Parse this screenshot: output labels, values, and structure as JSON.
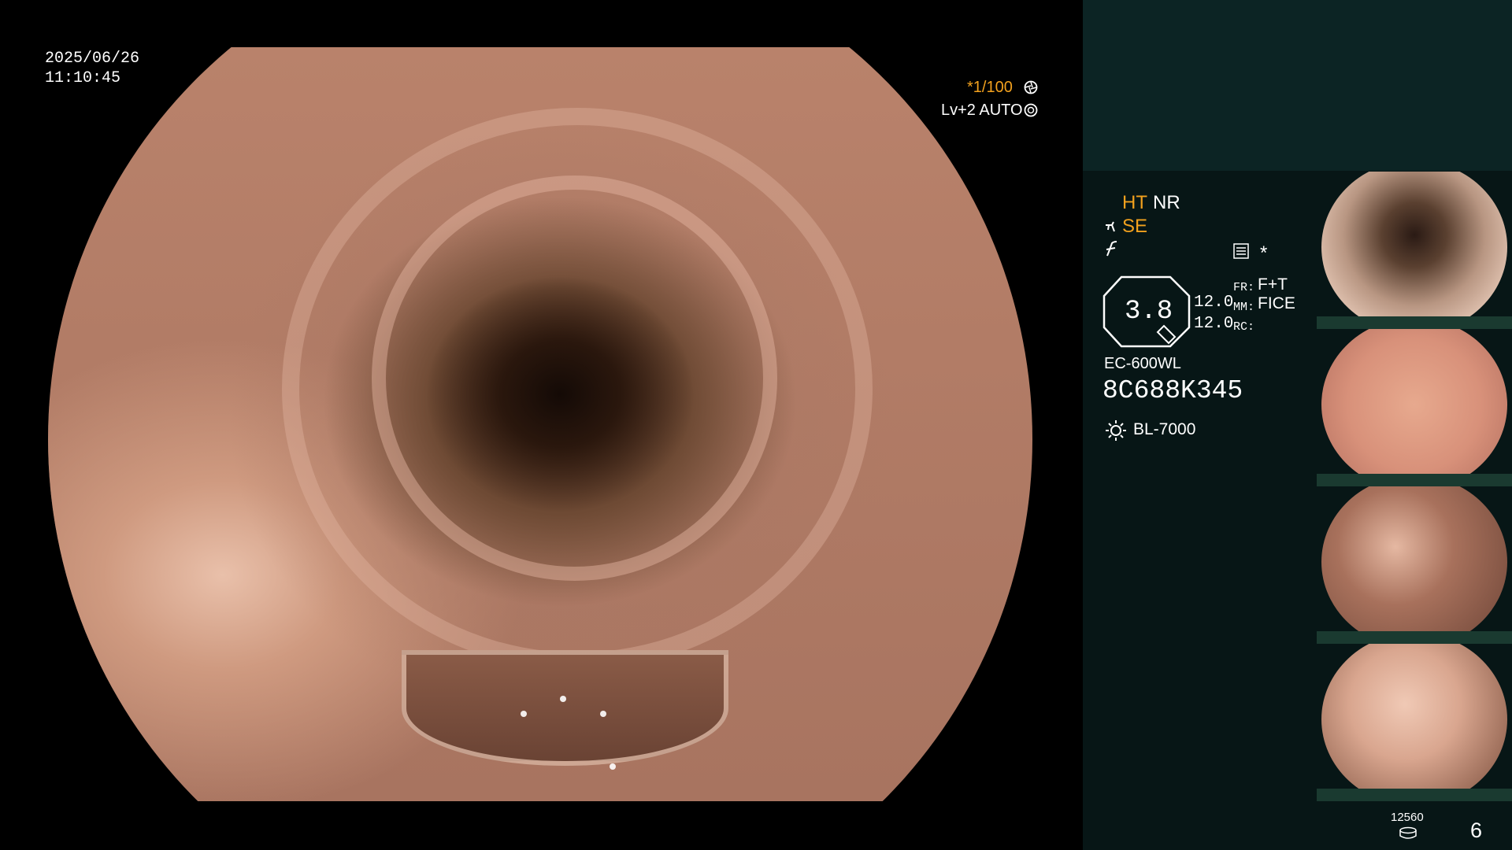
{
  "overlay": {
    "date": "2025/06/26",
    "time": "11:10:45",
    "shutter": "*1/100",
    "level": "Lv+2 AUTO"
  },
  "panel": {
    "ht": "HT",
    "nr": "NR",
    "se": "SE",
    "zoom": "3.8",
    "val1": "12.0",
    "val2": "12.0",
    "fr_label": "FR:",
    "fr_value": "F+T",
    "mm_label": "MM:",
    "mm_value": "FICE",
    "rc_label": "RC:",
    "model": "EC-600WL",
    "serial": "8C688K345",
    "light": "BL-7000",
    "storage": "12560",
    "count": "6",
    "asterisk": "*"
  },
  "colors": {
    "accent": "#f2a11e",
    "panel": "#071616",
    "panel_top": "#0c2424"
  },
  "icons": [
    "aperture-icon",
    "iris-icon",
    "scope-icon",
    "fiber-icon",
    "menu-list-icon",
    "light-icon",
    "disk-icon"
  ]
}
